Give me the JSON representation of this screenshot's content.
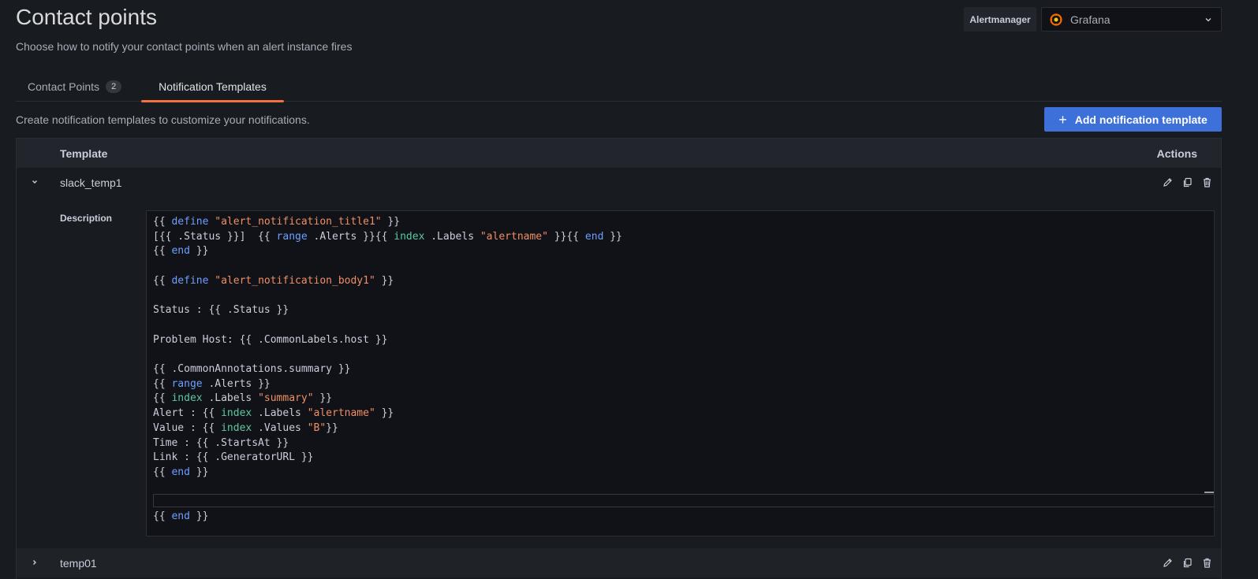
{
  "page": {
    "title": "Contact points",
    "subtitle": "Choose how to notify your contact points when an alert instance fires"
  },
  "alertmanager": {
    "label": "Alertmanager",
    "selected": "Grafana",
    "logo_icon": "grafana-logo-icon"
  },
  "tabs": [
    {
      "label": "Contact Points",
      "count": "2",
      "active": false
    },
    {
      "label": "Notification Templates",
      "active": true
    }
  ],
  "templates_section": {
    "helper_text": "Create notification templates to customize your notifications.",
    "add_button_label": "Add notification template",
    "columns": {
      "template": "Template",
      "actions": "Actions"
    },
    "rows": [
      {
        "name": "slack_temp1",
        "expanded": true,
        "description_label": "Description",
        "code_lines": [
          "{{ define \"alert_notification_title1\" }}",
          "[{{ .Status }}]  {{ range .Alerts }}{{ index .Labels \"alertname\" }}{{ end }}",
          "{{ end }}",
          "",
          "{{ define \"alert_notification_body1\" }}",
          "",
          "Status : {{ .Status }}",
          "",
          "Problem Host: {{ .CommonLabels.host }}",
          "",
          "{{ .CommonAnnotations.summary }}",
          "{{ range .Alerts }}",
          "{{ index .Labels \"summary\" }}",
          "Alert : {{ index .Labels \"alertname\" }}",
          "Value : {{ index .Values \"B\"}}",
          "Time : {{ .StartsAt }}",
          "Link : {{ .GeneratorURL }}",
          "{{ end }}",
          "",
          "",
          "{{ end }}"
        ]
      },
      {
        "name": "temp01",
        "expanded": false
      }
    ]
  },
  "colors": {
    "accent_button": "#3d71d9",
    "active_tab_underline": "#f56f3f",
    "keyword": "#6e9fff",
    "function": "#5fc7a0",
    "string": "#f08f65"
  }
}
